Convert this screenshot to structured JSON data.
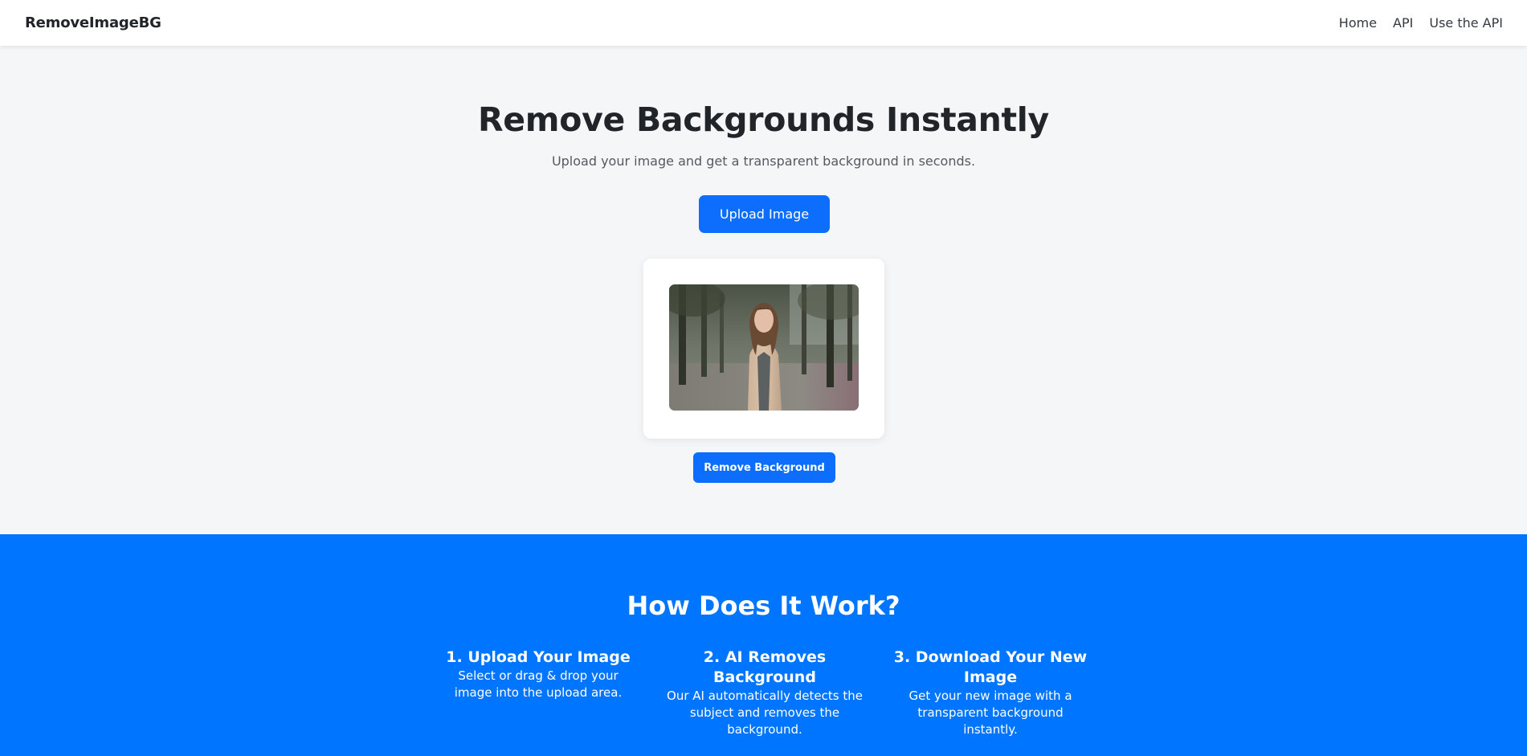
{
  "navbar": {
    "brand": "RemoveImageBG",
    "links": [
      "Home",
      "API",
      "Use the API"
    ]
  },
  "hero": {
    "title": "Remove Backgrounds Instantly",
    "subtitle": "Upload your image and get a transparent background in seconds.",
    "upload_label": "Upload Image",
    "remove_label": "Remove Background"
  },
  "how": {
    "title": "How Does It Work?",
    "steps": [
      {
        "title": "1. Upload Your Image",
        "text": "Select or drag & drop your image into the upload area."
      },
      {
        "title": "2. AI Removes Background",
        "text": "Our AI automatically detects the subject and removes the background."
      },
      {
        "title": "3. Download Your New Image",
        "text": "Get your new image with a transparent background instantly."
      }
    ]
  },
  "colors": {
    "primary": "#0d6efd",
    "how_bg": "#0075ff",
    "page_bg": "#f5f6f8"
  }
}
